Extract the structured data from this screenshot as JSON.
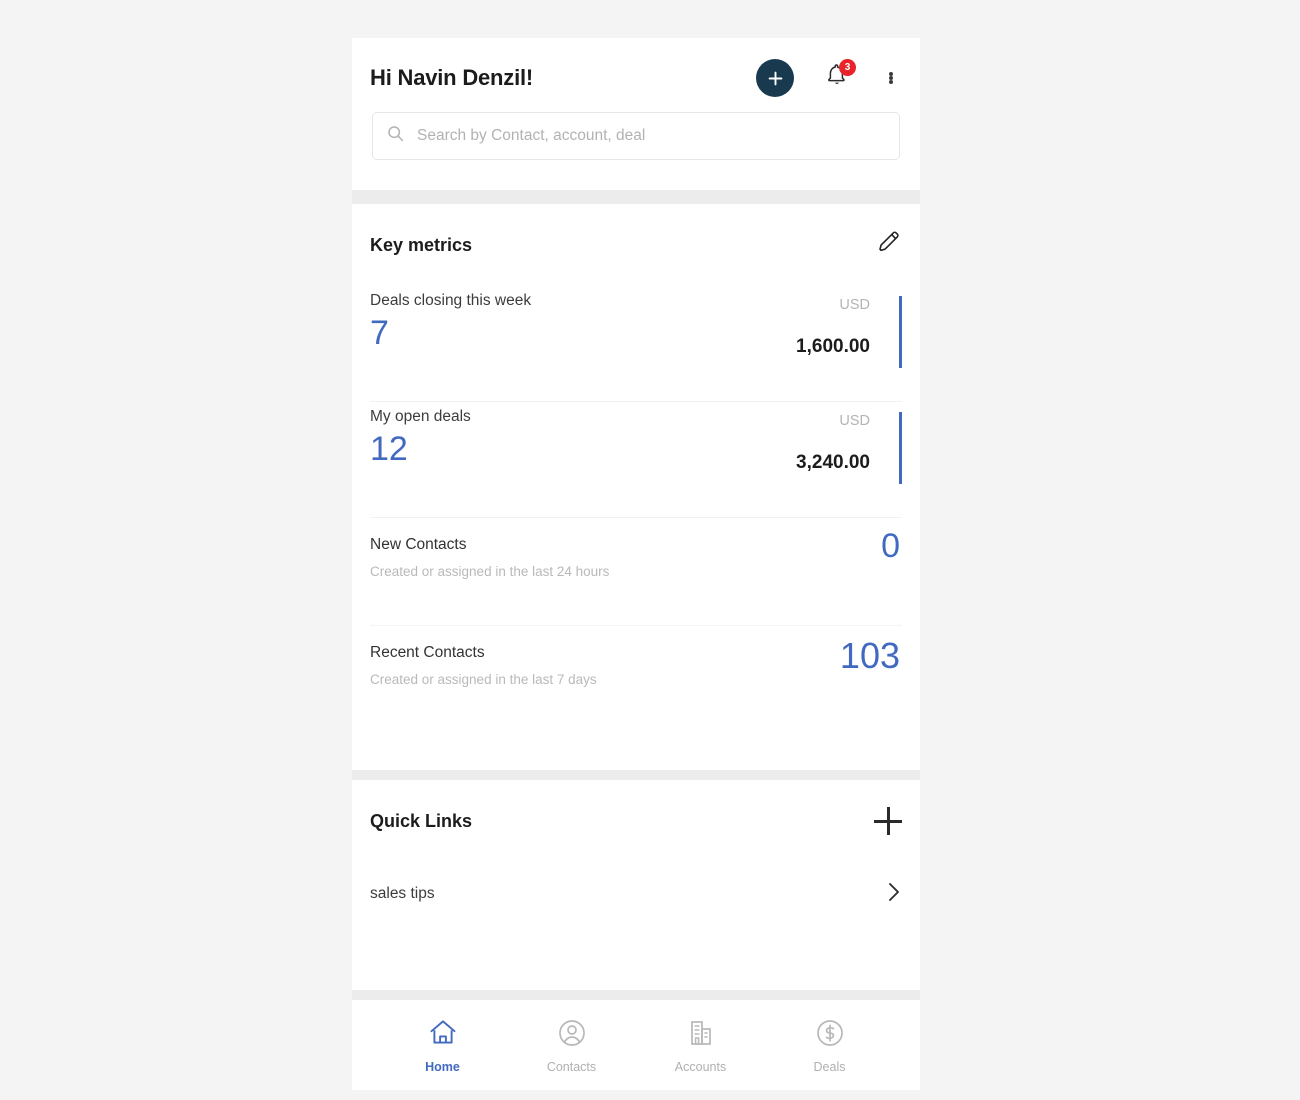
{
  "header": {
    "greeting": "Hi Navin Denzil!",
    "add_icon": "plus-icon",
    "notifications_icon": "bell-icon",
    "notifications_count": "3",
    "overflow_icon": "more-vertical-icon"
  },
  "search": {
    "icon": "search-icon",
    "placeholder": "Search by Contact, account, deal",
    "value": ""
  },
  "key_metrics": {
    "title": "Key metrics",
    "edit_icon": "pencil-icon",
    "deal_rows": [
      {
        "label": "Deals closing this week",
        "count": "7",
        "currency": "USD",
        "amount": "1,600.00"
      },
      {
        "label": "My open deals",
        "count": "12",
        "currency": "USD",
        "amount": "3,240.00"
      }
    ],
    "contact_rows": [
      {
        "label": "New Contacts",
        "sublabel": "Created or assigned in the last 24 hours",
        "value": "0"
      },
      {
        "label": "Recent Contacts",
        "sublabel": "Created or assigned in the last 7 days",
        "value": "103"
      }
    ]
  },
  "quick_links": {
    "title": "Quick Links",
    "add_icon": "plus-icon",
    "items": [
      {
        "label": "sales tips",
        "chevron_icon": "chevron-right-icon"
      }
    ]
  },
  "bottom_nav": {
    "items": [
      {
        "label": "Home",
        "icon": "home-icon",
        "active": true
      },
      {
        "label": "Contacts",
        "icon": "user-circle-icon",
        "active": false
      },
      {
        "label": "Accounts",
        "icon": "building-icon",
        "active": false
      },
      {
        "label": "Deals",
        "icon": "dollar-circle-icon",
        "active": false
      }
    ]
  },
  "colors": {
    "accent_blue": "#4269c0",
    "fab_navy": "#19394f",
    "badge_red": "#e8232a",
    "page_bg": "#f4f4f4",
    "muted_text": "#b4b4b4"
  }
}
